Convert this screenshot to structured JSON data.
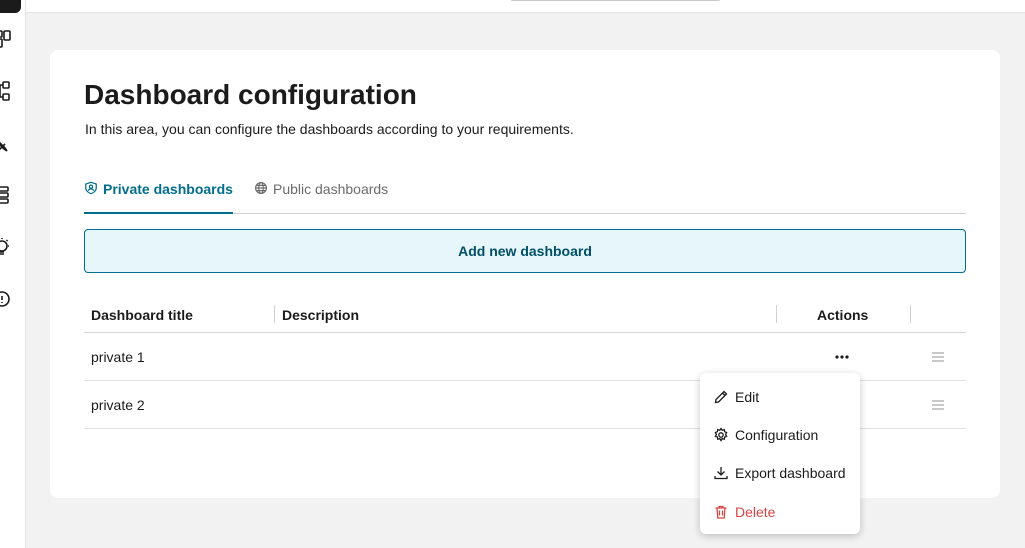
{
  "page": {
    "title": "Dashboard configuration",
    "subtitle": "In this area, you can configure the dashboards according to your requirements."
  },
  "tabs": [
    {
      "label": "Private dashboards",
      "icon": "shield-user-icon",
      "active": true
    },
    {
      "label": "Public dashboards",
      "icon": "globe-icon",
      "active": false
    }
  ],
  "add_button": {
    "label": "Add new dashboard"
  },
  "table": {
    "columns": [
      "Dashboard title",
      "Description",
      "Actions"
    ],
    "rows": [
      {
        "title": "private 1",
        "description": ""
      },
      {
        "title": "private 2",
        "description": ""
      }
    ]
  },
  "context_menu": {
    "items": [
      {
        "label": "Edit",
        "icon": "pencil-icon"
      },
      {
        "label": "Configuration",
        "icon": "gear-icon"
      },
      {
        "label": "Export dashboard",
        "icon": "download-icon"
      },
      {
        "label": "Delete",
        "icon": "trash-icon",
        "danger": true
      }
    ]
  },
  "colors": {
    "accent": "#006e8c",
    "accent_bg": "#e6f6fb",
    "danger": "#d64545",
    "background": "#f2f2f2"
  }
}
